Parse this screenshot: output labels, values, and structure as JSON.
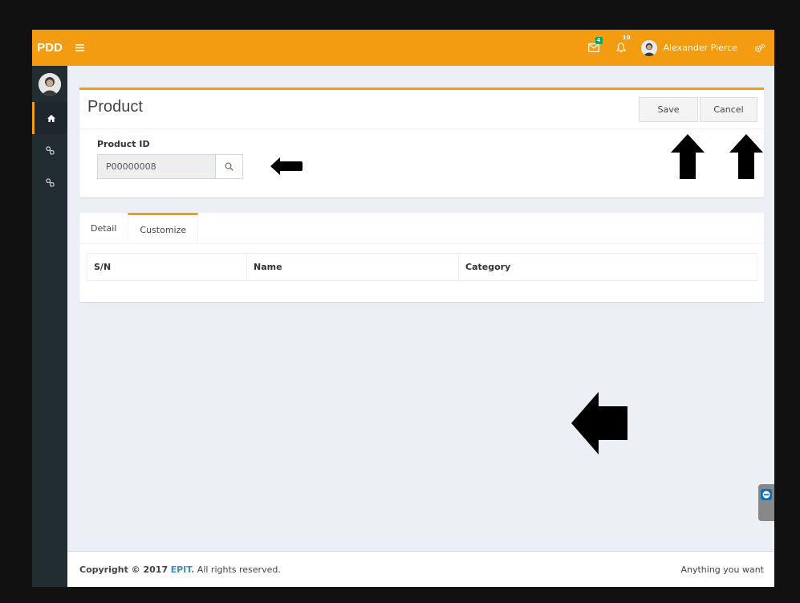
{
  "header": {
    "logo": "PDD",
    "menu_icon": "hamburger-icon",
    "mail_badge": "4",
    "notif_badge": "10",
    "user_name": "Alexander Pierce",
    "accent": "#f39c12"
  },
  "sidebar": {
    "items": [
      {
        "icon": "home-icon",
        "active": true
      },
      {
        "icon": "link-icon",
        "active": false
      },
      {
        "icon": "link-icon",
        "active": false
      }
    ]
  },
  "product": {
    "title": "Product",
    "save_label": "Save",
    "cancel_label": "Cancel",
    "id_label": "Product ID",
    "id_value": "P00000008"
  },
  "tabs": {
    "items": [
      {
        "label": "Detail",
        "active": false
      },
      {
        "label": "Customize",
        "active": true
      }
    ],
    "columns": [
      "S/N",
      "Name",
      "Category"
    ]
  },
  "footer": {
    "copyright_prefix": "Copyright © 2017",
    "brand": "EPIT.",
    "copyright_suffix": "All rights reserved.",
    "right_text": "Anything you want"
  }
}
